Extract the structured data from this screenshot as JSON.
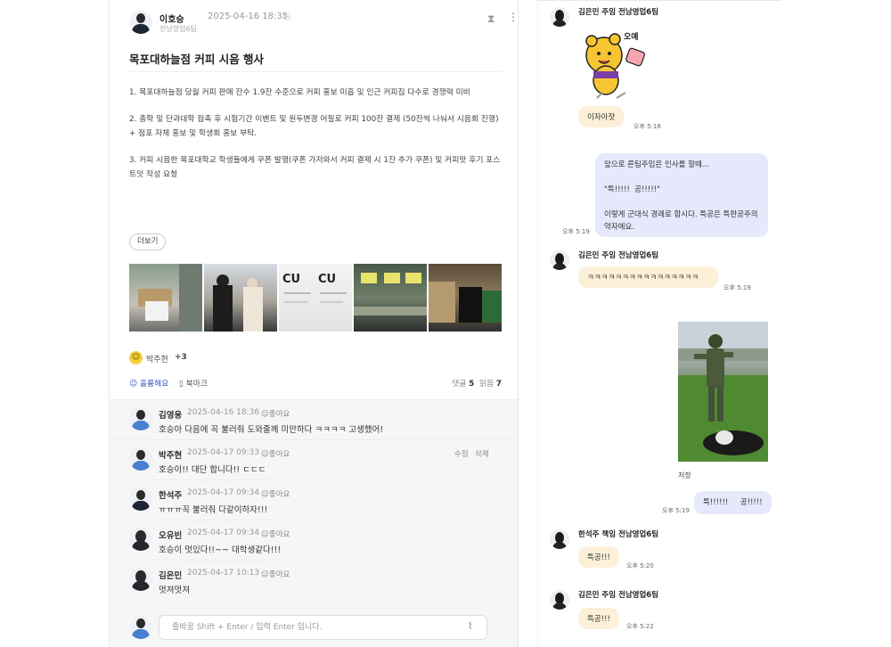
{
  "post": {
    "author": "이호승",
    "date": "2025-04-16 18:35",
    "team": "전남영업6팀",
    "title": "목포대하늘점 커피 시음 행사",
    "paragraphs": [
      "1. 목포대하늘점 당월 커피 판매 잔수 1.9잔 수준으로 커피 홍보 미흡 및 인근 커피집 다수로 경쟁력 미비",
      "2. 총학 및 단과대학 접촉 후 시험기간 이벤트 및 원두변경 어필로 커피 100잔 결제 (50잔씩 나눠서 시음회 진행)\n+ 점포 자체 홍보 및 학생회 홍보 부탁.",
      "3. 커피 시음한 목포대학교 학생들에게 쿠폰 발행(쿠폰 가저와서 커피 결제 시 1잔 추가 쿠폰) 및 커피맛 후기 포스트잇 작성 요청"
    ],
    "more_label": "더보기",
    "reactor_name": "박주현",
    "reactor_extra": "+3",
    "like_label": "훌륭해요",
    "bookmark_label": "북마크",
    "comments_label": "댓글",
    "comments_count": "5",
    "reads_label": "읽음",
    "reads_count": "7",
    "icons": {
      "person": "person-icon",
      "pin": "hourglass-pin-icon",
      "more": "more-vertical-icon"
    }
  },
  "comments": [
    {
      "name": "김영웅",
      "date": "2025-04-16 18:36",
      "like": "좋아요",
      "text": "호승아 다음에 꼭 불러줘 도와줄께 미안하다 ㅋㅋㅋㅋ 고생했어!"
    },
    {
      "name": "박주현",
      "date": "2025-04-17 09:33",
      "like": "좋아요",
      "text": "호승이!! 대단 합니다!! ㄷㄷㄷ",
      "edit": "수정",
      "delete": "삭제"
    },
    {
      "name": "한석주",
      "date": "2025-04-17 09:34",
      "like": "좋아요",
      "text": "ㅠㅠㅠ꼭 불러줘 다같이하자!!!"
    },
    {
      "name": "오유빈",
      "date": "2025-04-17 09:34",
      "like": "좋아요",
      "text": "호승이 멋있다!!~~ 대학생같다!!!"
    },
    {
      "name": "김은민",
      "date": "2025-04-17 10:13",
      "like": "좋아요",
      "text": "멋져멋져"
    }
  ],
  "composer": {
    "placeholder": "줄바꿈 Shift + Enter / 입력 Enter 입니다."
  },
  "chat": {
    "sender1": "김은민 주임 전남영업6팀",
    "msg1": "이자아잣",
    "time1": "오후 5:18",
    "out1": "앞으로 른팀주임은 인사를 할때...\n\n\"특!!!!!  공!!!!!\"\n\n이렇게 군대식 경례로 합시다. 특공은 특판공주의 약자에요.",
    "time_out1": "오후 5:19",
    "sender2": "김은민 주임 전남영업6팀",
    "msg2": "ㅋㅋㅋㅋㅋㅋㅋㅋㅋㅋㅋㅋㅋㅋㅋㅋ",
    "time2": "오후 5:19",
    "save_label": "저장",
    "out2": "특!!!!!!     공!!!!!",
    "time_out2": "오후 5:19",
    "sender3": "한석주 책임 전남영업6팀",
    "msg3": "특공!!!",
    "time3": "오후 5:20",
    "sender4": "김은민 주임 전남영업6팀",
    "msg4": "특공!!!",
    "time4": "오후 5:22",
    "sticker_text": "오예",
    "colors": {
      "incoming": "#fdf0d8",
      "outgoing": "#e6e8fb",
      "accent": "#3a56c5"
    }
  }
}
